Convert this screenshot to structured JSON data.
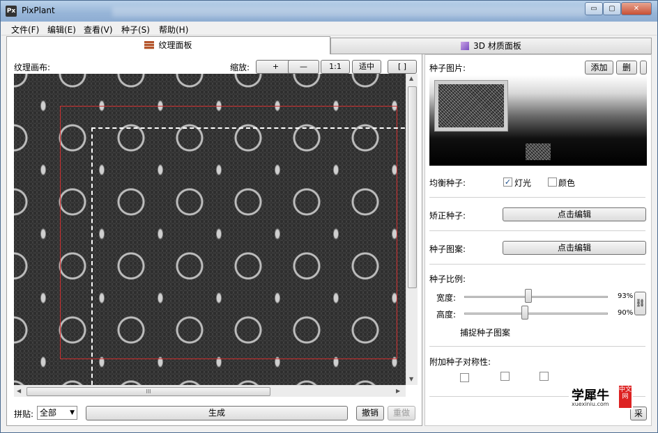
{
  "window": {
    "app_title": "PixPlant",
    "app_icon": "Px",
    "minimize": "▭",
    "maximize": "▢",
    "close": "✕"
  },
  "menu": [
    "文件(F)",
    "编辑(E)",
    "查看(V)",
    "种子(S)",
    "帮助(H)"
  ],
  "tabs": {
    "texture": "纹理面板",
    "material": "3D 材质面板"
  },
  "left": {
    "canvas_label": "纹理画布:",
    "zoom_label": "缩放:",
    "zoom_in": "+",
    "zoom_out": "—",
    "zoom_1to1": "1:1",
    "zoom_fit": "适中",
    "zoom_bracket": "[ ]",
    "tile_label": "拼贴:",
    "tile_value": "全部",
    "generate": "生成",
    "undo": "撤销",
    "redo": "重做",
    "hscroll_grip": "III"
  },
  "right": {
    "seed_image_label": "种子图片:",
    "add": "添加",
    "delete": "删",
    "balance_label": "均衡种子:",
    "light_label": "灯光",
    "light_checked": true,
    "color_label": "颜色",
    "color_checked": false,
    "straighten_label": "矫正种子:",
    "straighten_btn": "点击编辑",
    "pattern_label": "种子图案:",
    "pattern_btn": "点击编辑",
    "ratio_label": "种子比例:",
    "width_label": "宽度:",
    "width_value": "93%",
    "width_fraction": 0.93,
    "height_label": "高度:",
    "height_value": "90%",
    "height_fraction": 0.9,
    "capture_label": "捕捉种子图案",
    "symmetry_label": "附加种子对称性:",
    "partial_btn": "采"
  },
  "watermark": {
    "text": "学犀牛",
    "url": "xuexiniu.com",
    "badge": "中文网"
  }
}
